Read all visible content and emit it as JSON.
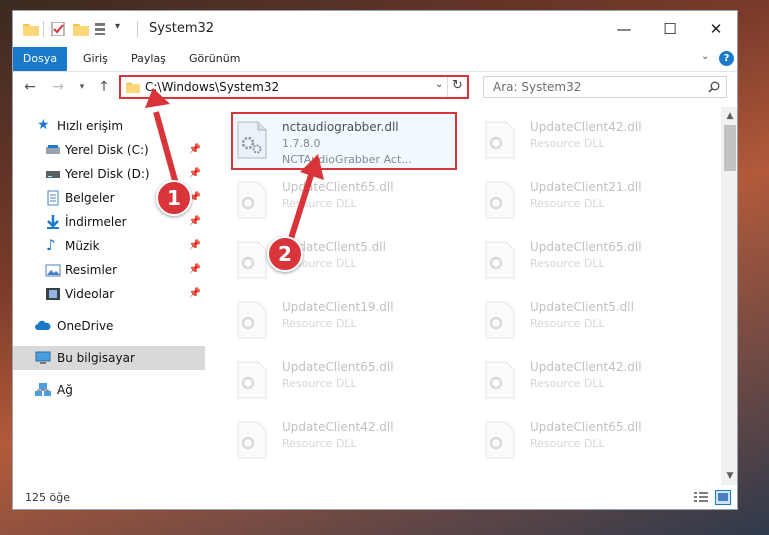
{
  "window": {
    "title": "System32"
  },
  "ribbon": {
    "tabs": [
      "Dosya",
      "Giriş",
      "Paylaş",
      "Görünüm"
    ]
  },
  "address": {
    "path": "C:\\Windows\\System32"
  },
  "search": {
    "placeholder": "Ara: System32"
  },
  "sidebar": {
    "items": [
      {
        "label": "Hızlı erişim",
        "icon": "star-icon"
      },
      {
        "label": "Yerel Disk (C:)",
        "icon": "drive-icon",
        "pinned": true
      },
      {
        "label": "Yerel Disk (D:)",
        "icon": "drive-icon",
        "pinned": true
      },
      {
        "label": "Belgeler",
        "icon": "documents-icon",
        "pinned": true
      },
      {
        "label": "İndirmeler",
        "icon": "download-icon",
        "pinned": true
      },
      {
        "label": "Müzik",
        "icon": "music-icon",
        "pinned": true
      },
      {
        "label": "Resimler",
        "icon": "pictures-icon",
        "pinned": true
      },
      {
        "label": "Videolar",
        "icon": "video-icon",
        "pinned": true
      },
      {
        "label": "OneDrive",
        "icon": "cloud-icon"
      },
      {
        "label": "Bu bilgisayar",
        "icon": "computer-icon",
        "selected": true
      },
      {
        "label": "Ağ",
        "icon": "network-icon"
      }
    ]
  },
  "files": [
    {
      "name": "nctaudiograbber.dll",
      "line2": "1.7.8.0",
      "line3": "NCTAudioGrabber Act..."
    },
    {
      "name": "UpdateClient42.dll",
      "line2": "Resource DLL"
    },
    {
      "name": "UpdateClient65.dll",
      "line2": "Resource DLL"
    },
    {
      "name": "UpdateClient21.dll",
      "line2": "Resource DLL"
    },
    {
      "name": "UpdateClient5.dll",
      "line2": "Resource DLL"
    },
    {
      "name": "UpdateClient65.dll",
      "line2": "Resource DLL"
    },
    {
      "name": "UpdateClient19.dll",
      "line2": "Resource DLL"
    },
    {
      "name": "UpdateClient5.dll",
      "line2": "Resource DLL"
    },
    {
      "name": "UpdateClient65.dll",
      "line2": "Resource DLL"
    },
    {
      "name": "UpdateClient42.dll",
      "line2": "Resource DLL"
    },
    {
      "name": "UpdateClient42.dll",
      "line2": "Resource DLL"
    },
    {
      "name": "UpdateClient65.dll",
      "line2": "Resource DLL"
    }
  ],
  "status": {
    "count": "125 öğe"
  },
  "annotations": {
    "step1": "1",
    "step2": "2",
    "color": "#d9343a"
  }
}
